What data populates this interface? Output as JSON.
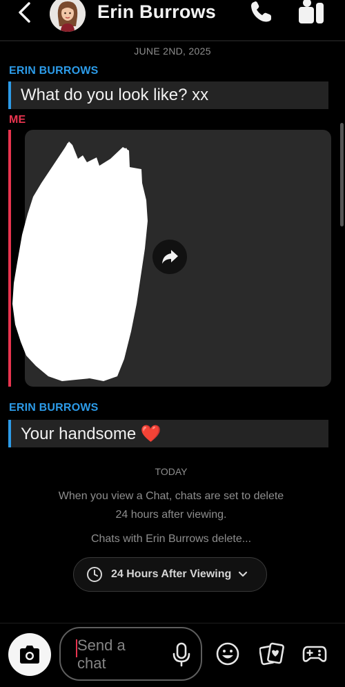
{
  "header": {
    "contact_name": "Erin Burrows"
  },
  "conversation": {
    "date_label": "JUNE 2ND, 2025",
    "messages": [
      {
        "sender": "ERIN BURROWS",
        "text": "What do you look like? xx"
      },
      {
        "sender": "ME",
        "type": "media"
      },
      {
        "sender": "ERIN BURROWS",
        "text": "Your handsome ❤️"
      }
    ],
    "today_label": "TODAY",
    "retention_info_line1": "When you view a Chat, chats are set to delete",
    "retention_info_line2": "24 hours after viewing.",
    "delete_notice": "Chats with Erin Burrows delete...",
    "retention_setting": "24 Hours After Viewing"
  },
  "composer": {
    "placeholder": "Send a chat"
  },
  "colors": {
    "friend_accent": "#2c9be8",
    "me_accent": "#e8344f",
    "bubble_bg": "#242424"
  },
  "icons": [
    "back-icon",
    "phone-icon",
    "video-call-icon",
    "share-arrow-icon",
    "clock-icon",
    "chevron-down-icon",
    "camera-icon",
    "mic-icon",
    "emoji-icon",
    "sticker-icon",
    "game-controller-icon"
  ]
}
